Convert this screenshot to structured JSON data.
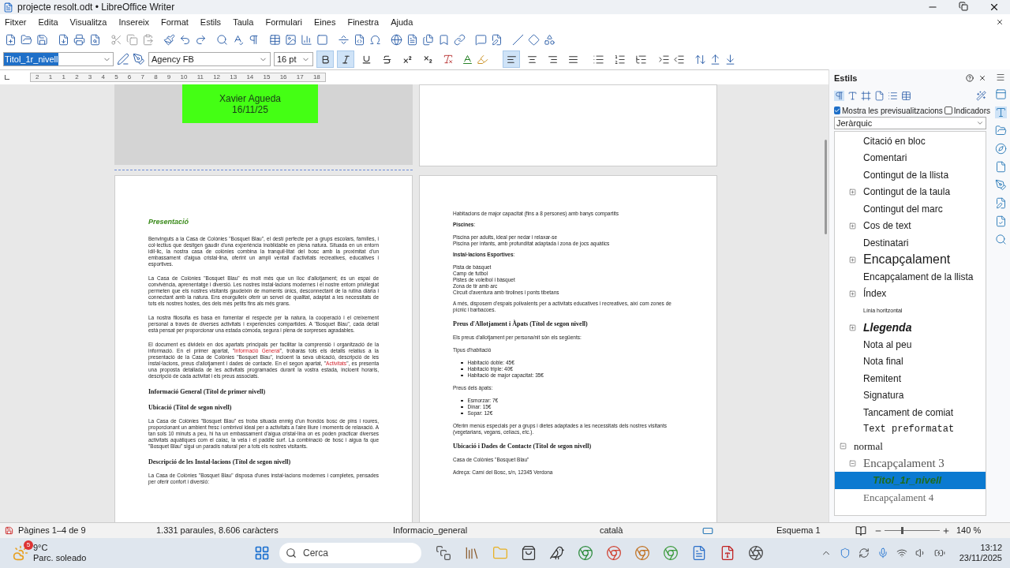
{
  "window": {
    "title": "projecte resolt.odt • LibreOffice Writer"
  },
  "menu": [
    "Fitxer",
    "Edita",
    "Visualitza",
    "Insereix",
    "Format",
    "Estils",
    "Taula",
    "Formulari",
    "Eines",
    "Finestra",
    "Ajuda"
  ],
  "formatting": {
    "paragraph_style": "Titol_1r_nivell",
    "font_name": "Agency FB",
    "font_size": "16 pt"
  },
  "format_buttons": [
    {
      "kind": "bold",
      "selected": true
    },
    {
      "kind": "italic",
      "selected": true
    },
    {
      "kind": "underline",
      "selected": false
    },
    {
      "kind": "strikethrough",
      "selected": false
    },
    {
      "kind": "superscript",
      "selected": false
    },
    {
      "kind": "subscript",
      "selected": false
    }
  ],
  "align_buttons": [
    {
      "kind": "left",
      "selected": true
    },
    {
      "kind": "center",
      "selected": false
    },
    {
      "kind": "right",
      "selected": false
    },
    {
      "kind": "justify",
      "selected": false
    }
  ],
  "ruler": [
    "2",
    "1",
    "1",
    "2",
    "3",
    "4",
    "5",
    "6",
    "7",
    "8",
    "9",
    "10",
    "11",
    "12",
    "13",
    "14",
    "15",
    "16",
    "17",
    "18"
  ],
  "cover_page": {
    "name": "Xavier Agueda",
    "date": "16/11/25"
  },
  "left_page": [
    {
      "kind": "title",
      "text": "Presentació"
    },
    {
      "kind": "para",
      "parts": [
        {
          "kind": "text",
          "text": "Benvinguts a la Casa de Colònies \"Bosquet Blau\", el destí perfecte per a grups escolars, famílies, i col·lectius que desitgen gaudir d'una experiència inoblidable en plena natura. Situada en un entorn idíl·lic, la nostra casa de colònies combina la tranquil·litat del bosc amb la proximitat d'un embassament d'aigua cristal·lina, oferint un ampli ventall d'activitats recreatives, educatives i esportives."
        }
      ]
    },
    {
      "kind": "para",
      "parts": [
        {
          "kind": "text",
          "text": "La Casa de Colònies \"Bosquet Blau\" és molt més que un lloc d'allotjament; és un espai de convivència, aprenentatge i diversió. Les nostres instal·lacions modernes i el nostre entorn privilegiat permeten que els nostres visitants gaudeixin de moments únics, desconnectant de la rutina diària i connectant amb la natura. Ens enorgulleix oferir un servei de qualitat, adaptat a les necessitats de tots els nostres hostes, des dels més petits fins als més grans."
        }
      ]
    },
    {
      "kind": "para",
      "parts": [
        {
          "kind": "text",
          "text": "La nostra filosofia es basa en fomentar el respecte per la natura, la cooperació i el creixement personal a través de diverses activitats i experiències compartides. A \"Bosquet Blau\", cada detall està pensat per proporcionar una estada còmoda, segura i plena de sorpreses agradables."
        }
      ]
    },
    {
      "kind": "para",
      "parts": [
        {
          "kind": "text",
          "text": "El document es divideix en dos apartats principals per facilitar la comprensió i organització de la informació. En el primer apartat, \""
        },
        {
          "kind": "link",
          "text": "Informació General"
        },
        {
          "kind": "text",
          "text": "\", trobaràs tots els detalls relatius a la presentació de la Casa de Colònies \"Bosquet Blau\", incloent la seva ubicació, descripció de les instal·lacions, preus d'allotjament i dades de contacte. En el segon apartat, \""
        },
        {
          "kind": "link",
          "text": "Activitats"
        },
        {
          "kind": "text",
          "text": "\", es presenta una proposta detallada de les activitats programades durant la vostra estada, incloent horaris, descripció de cada activitat i els preus associats."
        }
      ]
    },
    {
      "kind": "h1",
      "text": "Informació General (Títol de primer nivell)"
    },
    {
      "kind": "h2",
      "text": "Ubicació (Títol de segon nivell)"
    },
    {
      "kind": "para",
      "parts": [
        {
          "kind": "text",
          "text": "La Casa de Colònies \"Bosquet Blau\" es troba situada enmig d'un frondós bosc de pins i roures, proporcionant un ambient fresc i ombrívol ideal per a activitats a l'aire lliure i moments de relaxació. A tan sols 10 minuts a peu, hi ha un embassament d'aigua cristal·lina on es poden practicar diverses activitats aquàtiques com el caiac, la vela i el paddle surf. La combinació de bosc i aigua fa que \"Bosquet Blau\" sigui un paradís natural per a tots els nostres visitants."
        }
      ]
    },
    {
      "kind": "h2",
      "text": "Descripció de les Instal·lacions (Títol de segon nivell)"
    },
    {
      "kind": "para",
      "parts": [
        {
          "kind": "text",
          "text": "La Casa de Colònies \"Bosquet Blau\" disposa d'unes instal·lacions modernes i completes, pensades per oferir confort i diversió:"
        }
      ]
    }
  ],
  "right_page": [
    {
      "kind": "lines",
      "items": [
        "Habitacions de major capacitat (fins a 8 persones) amb banys compartits"
      ]
    },
    {
      "kind": "para",
      "text": "**Piscines**:"
    },
    {
      "kind": "lines",
      "items": [
        "Piscina per adults, ideal per nedar i relaxar-se",
        "Piscina per infants, amb profunditat adaptada i zona de jocs aquàtics"
      ]
    },
    {
      "kind": "para",
      "text": "**Instal·lacions Esportives**:"
    },
    {
      "kind": "lines",
      "items": [
        "Pista de bàsquet",
        "Camp de futbol",
        "Pistes de voleibol i bàsquet",
        "Zona de tir amb arc",
        "Circuit d'aventura amb tirolines i ponts tibetans"
      ]
    },
    {
      "kind": "para",
      "text": "A més, disposem d'espais polivalents per a activitats educatives i recreatives, així com zones de pícnic i barbacoes."
    },
    {
      "kind": "h2",
      "text": "Preus d'Allotjament i Àpats (Títol de segon nivell)"
    },
    {
      "kind": "para",
      "text": "Els preus d'allotjament per persona/nit són els següents:"
    },
    {
      "kind": "para",
      "text": "Tipus d'habitació"
    },
    {
      "kind": "bullets",
      "items": [
        "Habitació doble: 45€",
        "Habitació triple: 40€",
        "Habitació de major capacitat: 35€"
      ]
    },
    {
      "kind": "para",
      "text": "Preus dels àpats:"
    },
    {
      "kind": "bullets",
      "items": [
        "Esmorzar: 7€",
        "Dinar: 15€",
        "Sopar: 12€"
      ]
    },
    {
      "kind": "para",
      "text": "Oferim menús especials per a grups i dietes adaptades a les necessitats dels nostres visitants (vegetarians, vegans, celíacs, etc.)."
    },
    {
      "kind": "h2",
      "text": "Ubicació i Dades de Contacte (Títol de segon nivell)"
    },
    {
      "kind": "para",
      "text": "Casa de Colònies \"Bosquet Blau\""
    },
    {
      "kind": "para",
      "text": "Adreça: Camí del Bosc, s/n, 12345 Verdona"
    }
  ],
  "sidebar": {
    "title": "Estils",
    "show_previews": {
      "label": "Mostra les previsualitzacions",
      "checked": true
    },
    "indicators": {
      "label": "Indicadors",
      "checked": false
    },
    "filter": "Jeràrquic",
    "styles_continued": [
      {
        "label": "Citació en bloc",
        "kind": "plain",
        "selected": false
      },
      {
        "label": "Comentari",
        "kind": "plain",
        "selected": false
      },
      {
        "label": "Contingut de la llista",
        "kind": "plain",
        "selected": false
      },
      {
        "label": "Contingut de la taula",
        "kind": "plain",
        "selected": false,
        "expanded": false
      },
      {
        "label": "Contingut del marc",
        "kind": "plain",
        "selected": false
      },
      {
        "label": "Cos de text",
        "kind": "plain",
        "selected": false,
        "expanded": false
      },
      {
        "label": "Destinatari",
        "kind": "plain",
        "selected": false
      },
      {
        "label": "Encapçalament",
        "kind": "large",
        "selected": false,
        "expanded": false
      },
      {
        "label": "Encapçalament de la llista",
        "kind": "plain",
        "selected": false
      },
      {
        "label": "Índex",
        "kind": "plain",
        "selected": false,
        "expanded": false
      },
      {
        "label": "Línia horitzontal",
        "kind": "tiny",
        "selected": false
      },
      {
        "label": "Llegenda",
        "kind": "italic",
        "selected": false,
        "expanded": false
      },
      {
        "label": "Nota al peu",
        "kind": "plain",
        "selected": false
      },
      {
        "label": "Nota final",
        "kind": "plain",
        "selected": false
      },
      {
        "label": "Remitent",
        "kind": "plain",
        "selected": false
      },
      {
        "label": "Signatura",
        "kind": "plain",
        "selected": false
      },
      {
        "label": "Tancament de comiat",
        "kind": "plain",
        "selected": false
      },
      {
        "label": "Text preformatat",
        "kind": "mono",
        "selected": false
      }
    ],
    "styles": [
      {
        "label": "normal",
        "kind": "serif",
        "selected": false,
        "expanded": true,
        "children": [
          {
            "label": "Encapçalament 3",
            "kind": "serif-large",
            "selected": false,
            "expanded": true,
            "children": [
              {
                "label": "Titol_1r_nivell",
                "kind": "title",
                "selected": true
              }
            ]
          },
          {
            "label": "Encapçalament 4",
            "kind": "serif-muted",
            "selected": false
          }
        ]
      }
    ]
  },
  "status_bar": {
    "pages": "Pàgines 1–4 de 9",
    "words": "1.331 paraules, 8.606 caràcters",
    "page_style": "Informacio_general",
    "language": "català",
    "outline": "Esquema 1",
    "zoom": "140 %",
    "zoom_slider": {
      "level": 0.3
    }
  },
  "taskbar": {
    "weather_badge": "5",
    "temperature": "9°C",
    "weather": "Parc. soleado",
    "search": "Cerca",
    "time": "13:12",
    "date": "23/11/2025"
  }
}
